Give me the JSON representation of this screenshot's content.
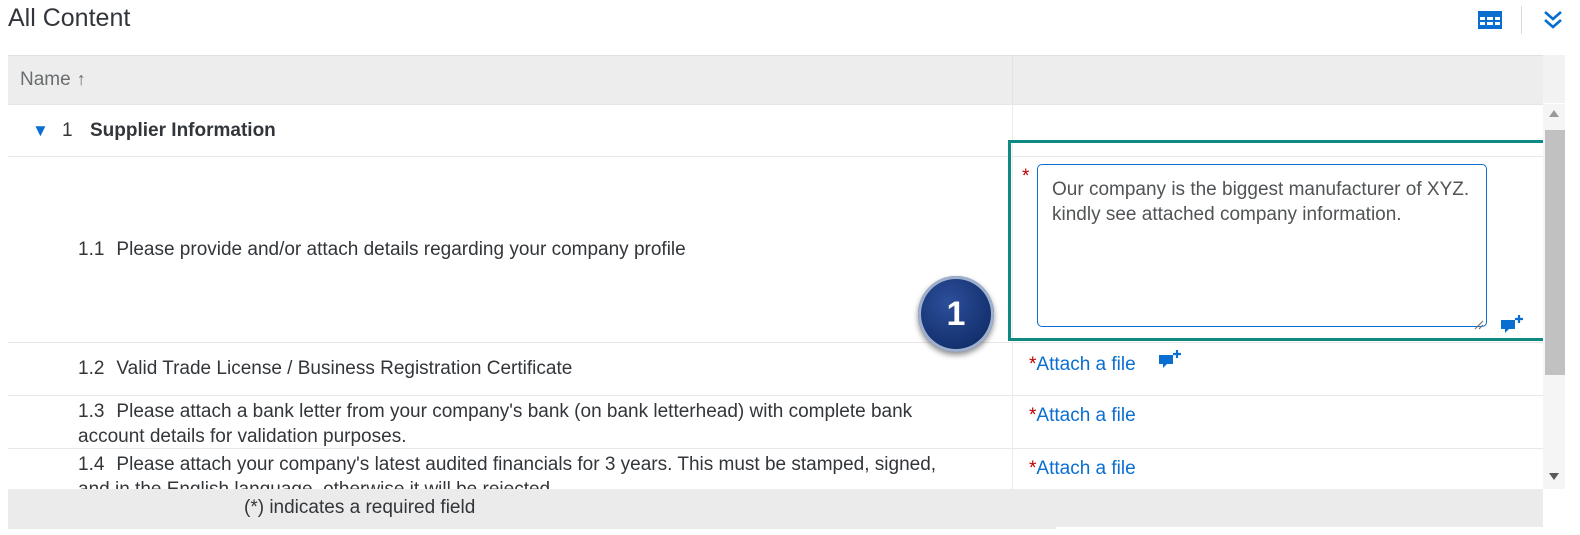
{
  "page": {
    "title": "All Content"
  },
  "toolbar": {
    "grid_icon": "table-view-icon",
    "expand_icon": "expand-all-icon"
  },
  "table": {
    "header": {
      "name": "Name",
      "sort_arrow": "↑"
    },
    "section": {
      "number": "1",
      "title": "Supplier Information"
    },
    "rows": [
      {
        "number": "1.1",
        "text": "Please provide and/or attach details regarding your company profile"
      },
      {
        "number": "1.2",
        "text": "Valid Trade License / Business Registration Certificate"
      },
      {
        "number": "1.3",
        "text": "Please attach a bank letter from your company's bank (on bank letterhead) with complete bank account details for validation purposes."
      },
      {
        "number": "1.4",
        "text": "Please attach your company's latest audited financials for 3 years. This must be stamped, signed, and in the English language, otherwise it will be rejected."
      }
    ],
    "answer_1_1": "Our company is the biggest manufacturer of XYZ. kindly see attached company information.",
    "required_marker": "*",
    "attach_label": "Attach a file"
  },
  "annotation": {
    "badge": "1"
  },
  "footer": {
    "text": "(*) indicates a required field"
  },
  "colors": {
    "accent": "#0a6ed1",
    "highlight": "#0f8a82",
    "required": "#bb0000",
    "badge": "#1b3a7a"
  }
}
